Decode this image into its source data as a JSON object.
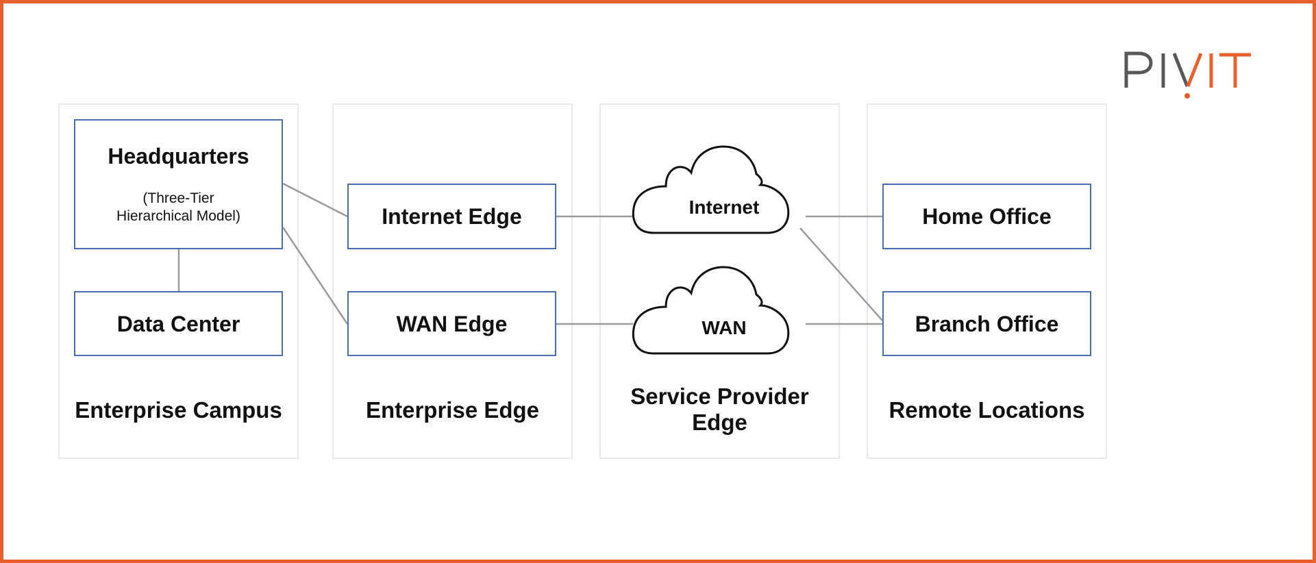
{
  "logo": {
    "part1": "PIV",
    "part2": "IT",
    "slash_dot": "!"
  },
  "colors": {
    "frame": "#E8602C",
    "node_border": "#4A6FB0",
    "connector": "#9A9A9A",
    "panel_border": "#E8E8E8"
  },
  "panels": [
    {
      "label": "Enterprise Campus"
    },
    {
      "label": "Enterprise Edge"
    },
    {
      "label": "Service Provider",
      "label_line2": "Edge"
    },
    {
      "label": "Remote Locations"
    }
  ],
  "nodes": {
    "headquarters": {
      "title": "Headquarters",
      "subtitle_line1": "(Three-Tier",
      "subtitle_line2": "Hierarchical Model)"
    },
    "data_center": {
      "title": "Data Center"
    },
    "internet_edge": {
      "title": "Internet Edge"
    },
    "wan_edge": {
      "title": "WAN Edge"
    },
    "internet_cloud": {
      "title": "Internet"
    },
    "wan_cloud": {
      "title": "WAN"
    },
    "home_office": {
      "title": "Home Office"
    },
    "branch_office": {
      "title": "Branch Office"
    }
  },
  "connections": [
    [
      "headquarters",
      "data_center"
    ],
    [
      "headquarters",
      "internet_edge"
    ],
    [
      "headquarters",
      "wan_edge"
    ],
    [
      "internet_edge",
      "internet_cloud"
    ],
    [
      "wan_edge",
      "wan_cloud"
    ],
    [
      "internet_cloud",
      "home_office"
    ],
    [
      "internet_cloud",
      "branch_office"
    ],
    [
      "wan_cloud",
      "branch_office"
    ]
  ]
}
